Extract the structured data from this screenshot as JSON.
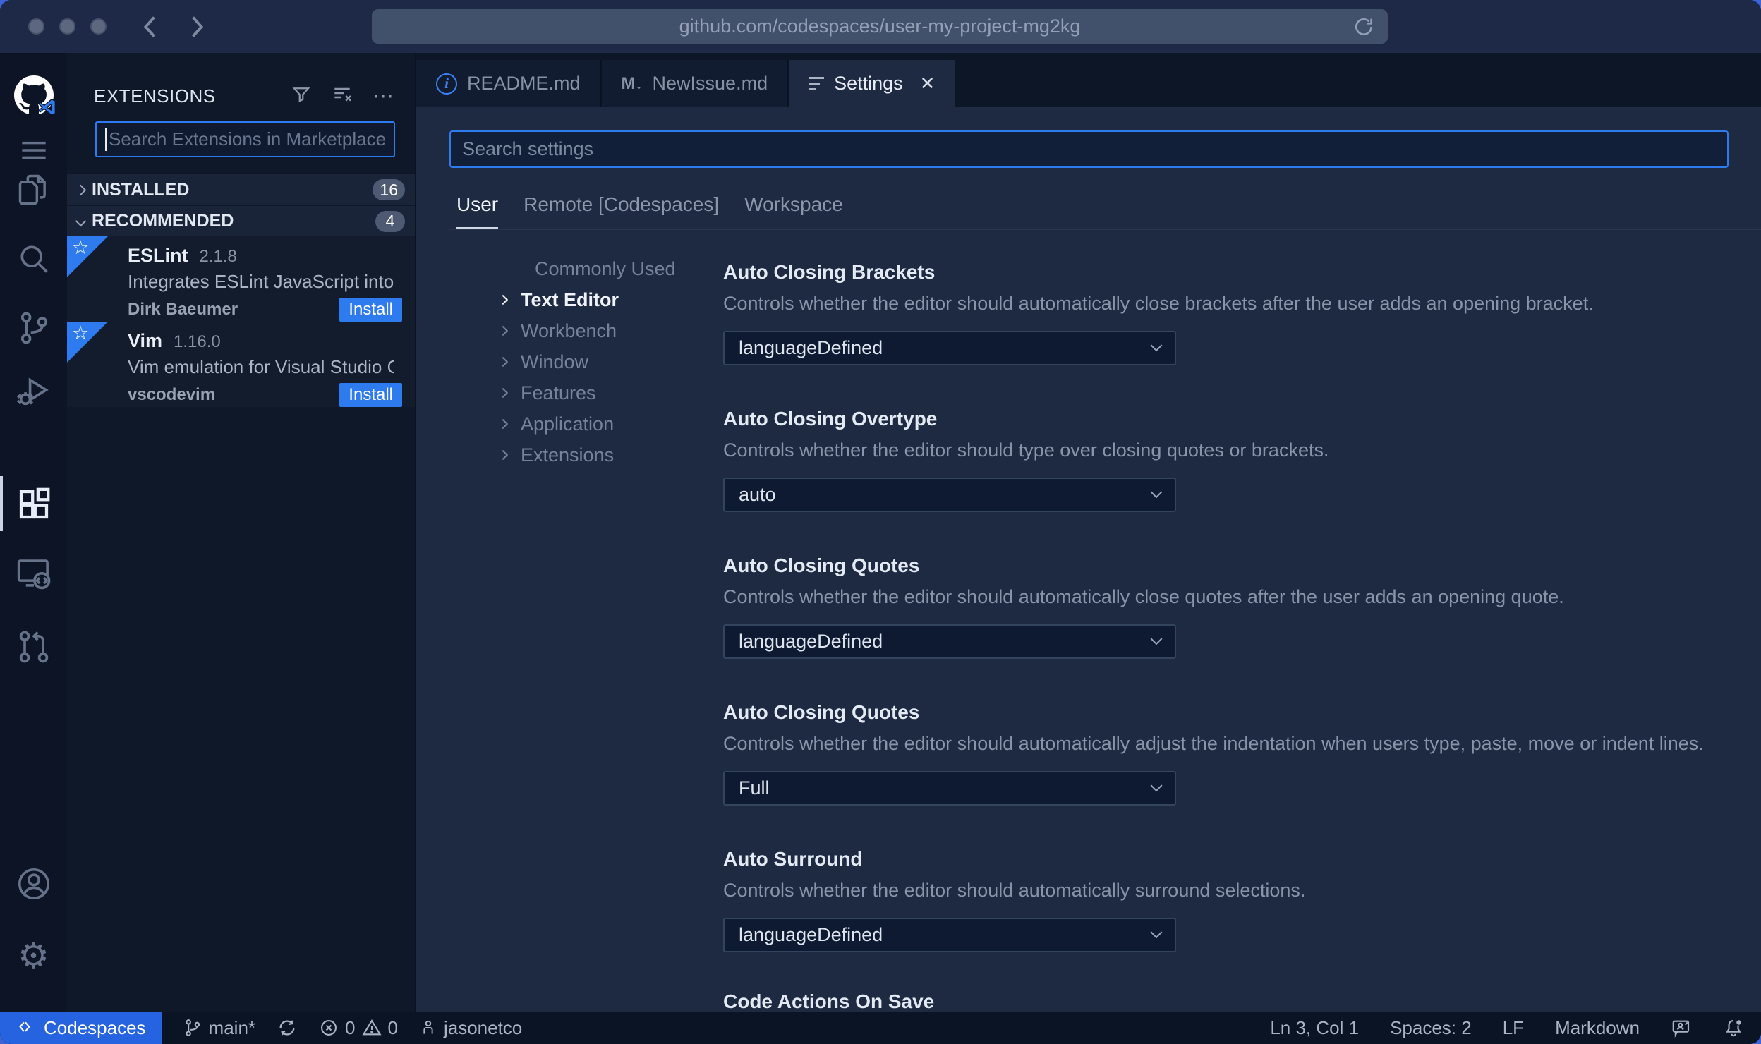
{
  "browser": {
    "url": "github.com/codespaces/user-my-project-mg2kg"
  },
  "activity_bar": {
    "items": [
      "github-codespaces-logo",
      "menu",
      "explorer",
      "search",
      "source-control",
      "run-and-debug",
      "extensions",
      "remote-explorer",
      "pull-requests",
      "account",
      "settings-gear"
    ],
    "active": "extensions"
  },
  "sidebar": {
    "title": "EXTENSIONS",
    "search_placeholder": "Search Extensions in Marketplace",
    "sections": [
      {
        "label": "INSTALLED",
        "count": "16"
      },
      {
        "label": "RECOMMENDED",
        "count": "4"
      }
    ],
    "extensions": [
      {
        "name": "ESLint",
        "version": "2.1.8",
        "description": "Integrates ESLint JavaScript into VS C...",
        "author": "Dirk Baeumer",
        "action": "Install"
      },
      {
        "name": "Vim",
        "version": "1.16.0",
        "description": "Vim emulation for Visual Studio Code...",
        "author": "vscodevim",
        "action": "Install"
      }
    ]
  },
  "tabs": [
    {
      "label": "README.md"
    },
    {
      "label": "NewIssue.md"
    },
    {
      "label": "Settings",
      "close": "✕"
    }
  ],
  "settings": {
    "search_placeholder": "Search settings",
    "scopes": [
      {
        "label": "User"
      },
      {
        "label": "Remote [Codespaces]"
      },
      {
        "label": "Workspace"
      }
    ],
    "toc": [
      {
        "label": "Commonly Used"
      },
      {
        "label": "Text Editor"
      },
      {
        "label": "Workbench"
      },
      {
        "label": "Window"
      },
      {
        "label": "Features"
      },
      {
        "label": "Application"
      },
      {
        "label": "Extensions"
      }
    ],
    "sections": [
      {
        "title": "Auto Closing Brackets",
        "description": "Controls whether the editor should automatically close brackets after the user adds an opening bracket.",
        "value": "languageDefined"
      },
      {
        "title": "Auto Closing Overtype",
        "description": "Controls whether the editor should type over closing quotes or brackets.",
        "value": "auto"
      },
      {
        "title": "Auto Closing Quotes",
        "description": "Controls whether the editor should automatically close quotes after the user adds an opening quote.",
        "value": "languageDefined"
      },
      {
        "title": "Auto Closing Quotes",
        "description": "Controls whether the editor should automatically adjust the indentation when users type, paste, move or indent lines.",
        "value": "Full"
      },
      {
        "title": "Auto Surround",
        "description": "Controls whether the editor should automatically surround selections.",
        "value": "languageDefined"
      },
      {
        "title": "Code Actions On Save"
      }
    ]
  },
  "status_bar": {
    "remote": "Codespaces",
    "branch": "main*",
    "errors": "0",
    "warnings": "0",
    "user": "jasonetco",
    "cursor": "Ln 3, Col 1",
    "indent": "Spaces: 2",
    "eol": "LF",
    "language": "Markdown"
  },
  "colors": {
    "accent": "#2e7bf0",
    "codespaces_button": "#2663e0",
    "editor_bg": "#1d2a41",
    "panel_bg": "#0e1829",
    "badge_bg": "#4d5a72"
  }
}
